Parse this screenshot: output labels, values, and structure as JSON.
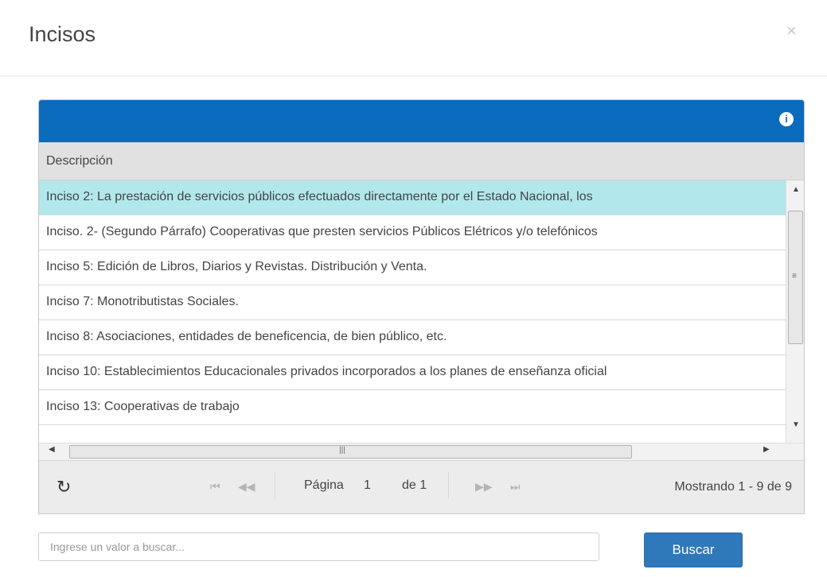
{
  "modal": {
    "title": "Incisos",
    "close_glyph": "×"
  },
  "grid": {
    "caption_icon": "info-icon",
    "columns": [
      "Descripción"
    ],
    "rows": [
      "Inciso 2: La prestación de servicios públicos efectuados directamente por el Estado Nacional, los",
      "Inciso. 2- (Segundo Párrafo) Cooperativas que presten servicios Públicos Elétricos  y/o telefónicos",
      "Inciso 5: Edición de Libros, Diarios y Revistas. Distribución y Venta.",
      "Inciso 7: Monotributistas Sociales.",
      "Inciso 8: Asociaciones, entidades de beneficencia, de bien público, etc.",
      "Inciso 10: Establecimientos Educacionales privados incorporados a los planes de enseñanza oficial",
      "Inciso 13: Cooperativas de trabajo"
    ],
    "selected_row": 0
  },
  "pager": {
    "page_label": "Página",
    "current_page": "1",
    "of_label": "de 1",
    "record_info": "Mostrando 1 - 9 de 9"
  },
  "search": {
    "placeholder": "Ingrese un valor a buscar...",
    "button_label": "Buscar"
  },
  "colors": {
    "caption": "#0a6bbd",
    "selected_row": "#b2e8ec",
    "button": "#2f78ba"
  }
}
